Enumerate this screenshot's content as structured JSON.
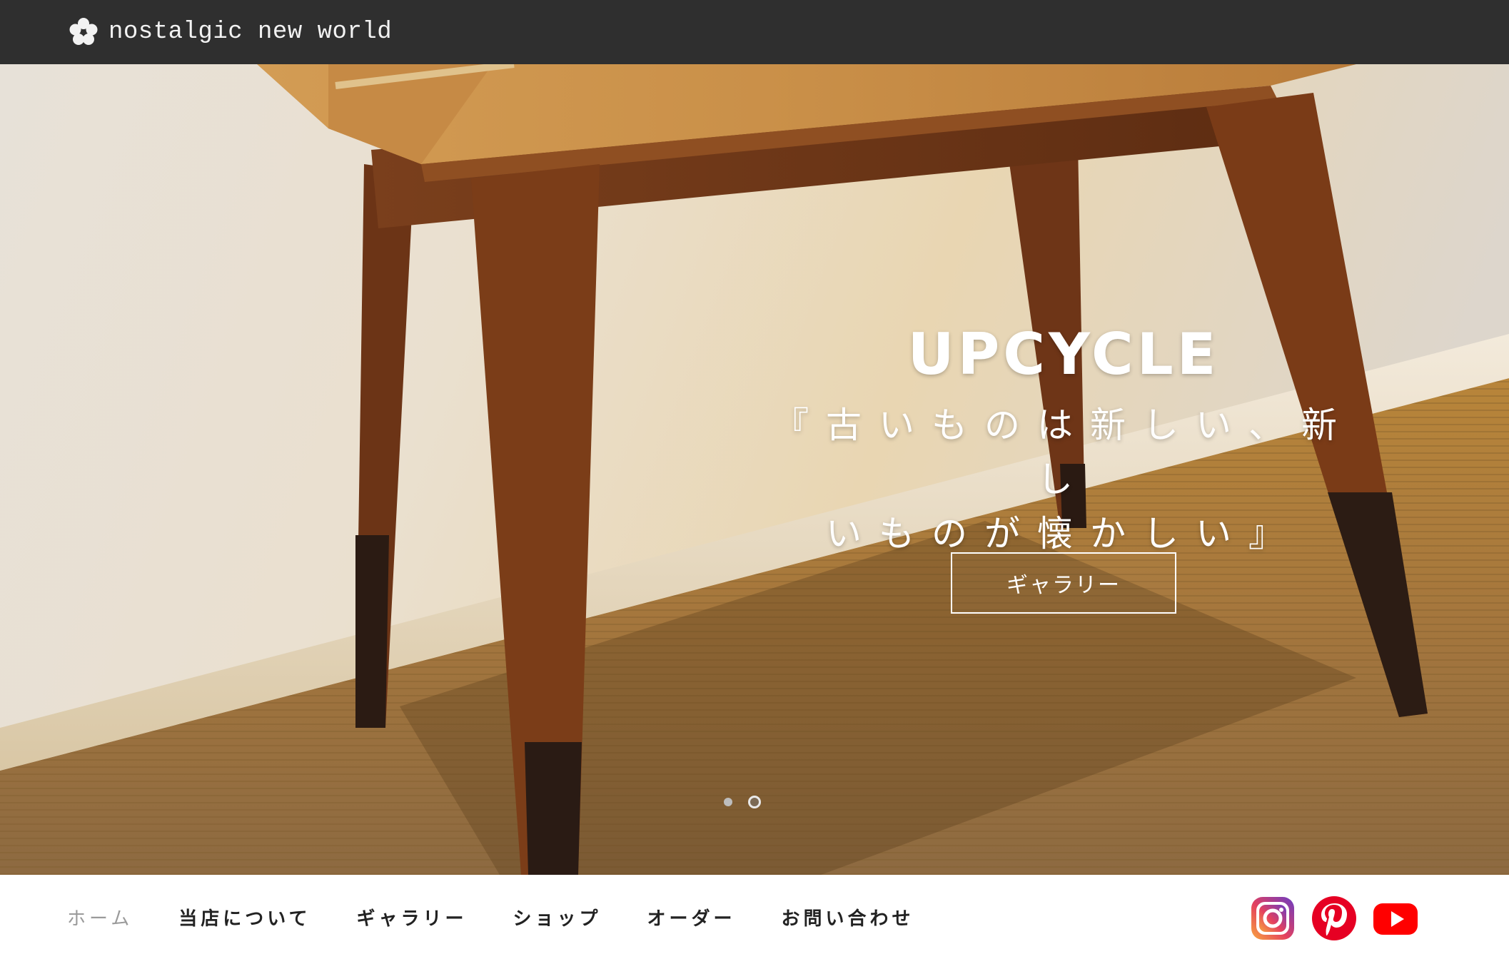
{
  "header": {
    "brand_name": "nostalgic new world",
    "logo_icon": "flower-logo-icon"
  },
  "hero": {
    "title": "UPCYCLE",
    "subtitle_line1": "『古いものは新しい、新し",
    "subtitle_line2": "いものが懐かしい』",
    "button_label": "ギャラリー",
    "slides_total": 2,
    "active_slide": 2
  },
  "nav": {
    "items": [
      {
        "label": "ホーム",
        "active": true
      },
      {
        "label": "当店について",
        "active": false
      },
      {
        "label": "ギャラリー",
        "active": false
      },
      {
        "label": "ショップ",
        "active": false
      },
      {
        "label": "オーダー",
        "active": false
      },
      {
        "label": "お問い合わせ",
        "active": false
      }
    ]
  },
  "social": {
    "icons": [
      "instagram-icon",
      "pinterest-icon",
      "youtube-icon"
    ]
  },
  "colors": {
    "topbar": "#2f2f2f",
    "nav_active": "#9a9a9a",
    "nav_text": "#222222",
    "pinterest": "#e60023",
    "youtube": "#ff0000"
  }
}
